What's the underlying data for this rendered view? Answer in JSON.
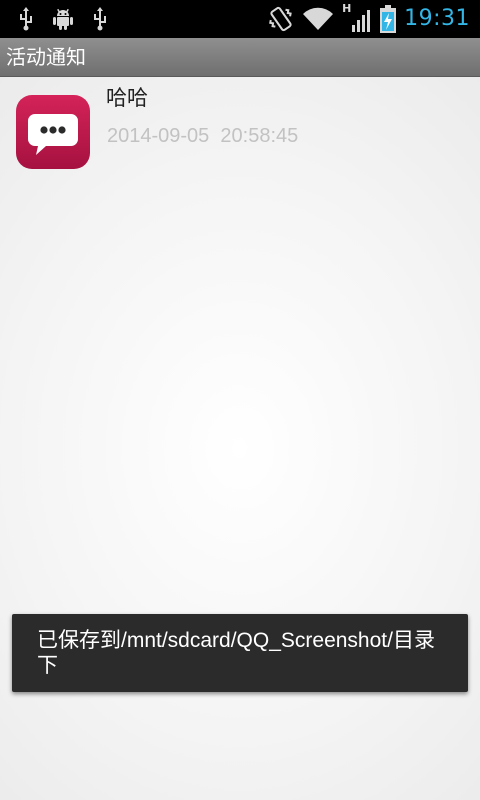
{
  "status_bar": {
    "time": "19:31",
    "network_type": "H",
    "icons": [
      "usb-icon",
      "android-debug-icon",
      "usb-icon",
      "vibrate-icon",
      "wifi-icon",
      "signal-icon",
      "battery-charging-icon"
    ]
  },
  "title_bar": {
    "title": "活动通知"
  },
  "notification": {
    "title": "哈哈",
    "timestamp": "2014-09-05  20:58:45",
    "icon": "chat-bubble-icon",
    "icon_color": "#c2184a"
  },
  "toast": {
    "message": "已保存到/mnt/sdcard/QQ_Screenshot/目录下"
  },
  "colors": {
    "time_accent": "#33b5e5",
    "title_bar": "#7f7f7f",
    "toast_bg": "#2b2b2b"
  }
}
